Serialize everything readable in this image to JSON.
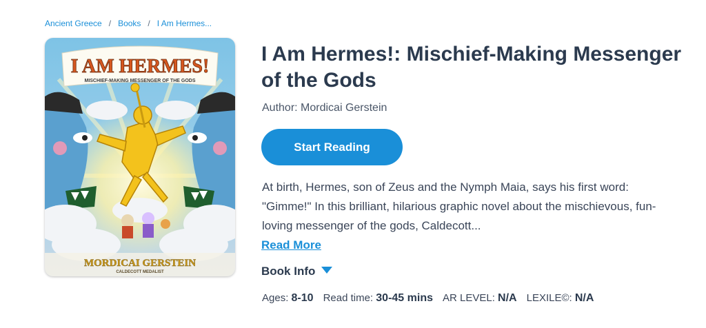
{
  "breadcrumb": {
    "items": [
      {
        "label": "Ancient Greece"
      },
      {
        "label": "Books"
      },
      {
        "label": "I Am Hermes..."
      }
    ],
    "separator": "/"
  },
  "book": {
    "cover_title": "I AM HERMES!",
    "cover_subtitle": "MISCHIEF-MAKING MESSENGER OF THE GODS",
    "cover_author": "MORDICAI GERSTEIN",
    "cover_tagline": "CALDECOTT MEDALIST",
    "title": "I Am Hermes!: Mischief-Making Messenger of the Gods",
    "author": "Author: Mordicai Gerstein",
    "start_label": "Start Reading",
    "description": "At birth, Hermes, son of Zeus and the Nymph Maia, says his first word: \"Gimme!\" In this brilliant, hilarious graphic novel about the mischievous, fun-loving messenger of the gods, Caldecott...",
    "read_more": "Read More",
    "book_info_label": "Book Info"
  },
  "meta": {
    "ages_label": "Ages:",
    "ages_value": "8-10",
    "read_time_label": "Read time:",
    "read_time_value": "30-45 mins",
    "ar_label": "AR LEVEL:",
    "ar_value": "N/A",
    "lexile_label": "LEXILE©:",
    "lexile_value": "N/A"
  },
  "icons": {
    "book_info_toggle": "caret-down-icon"
  },
  "colors": {
    "accent": "#1a8fd8",
    "text": "#2b3a4e"
  }
}
